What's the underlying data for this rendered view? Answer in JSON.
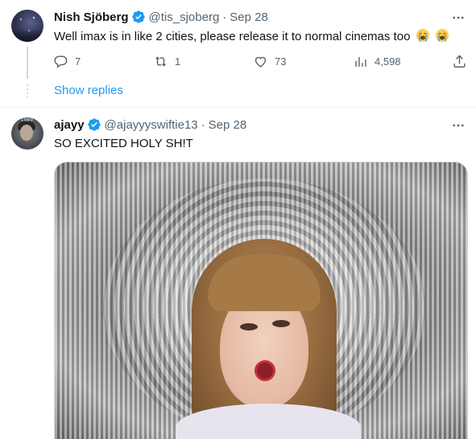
{
  "tweets": [
    {
      "name": "Nish Sjöberg",
      "handle": "@tis_sjoberg",
      "separator": "·",
      "date": "Sep 28",
      "text": "Well imax is in like 2 cities, please release it to normal cinemas too",
      "emojis": [
        "loudly-crying-face",
        "loudly-crying-face"
      ],
      "stats": {
        "replies": "7",
        "retweets": "1",
        "likes": "73",
        "views": "4,598"
      },
      "show_replies": "Show replies"
    },
    {
      "name": "ajayy",
      "handle": "@ajayyyswiftie13",
      "separator": "·",
      "date": "Sep 28",
      "text": "SO EXCITED HOLY SH!T"
    }
  ],
  "avatar2_tag": "1989",
  "colors": {
    "accent": "#1d9bf0",
    "muted": "#536471",
    "text": "#0f1419"
  }
}
